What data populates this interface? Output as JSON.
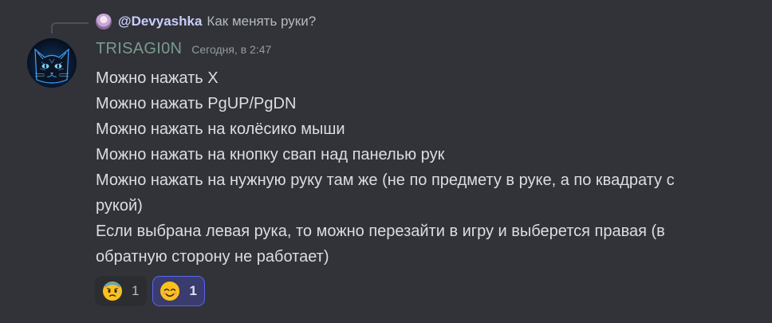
{
  "reply": {
    "author": "@Devyashka",
    "text": "Как менять руки?"
  },
  "message": {
    "author": "TRISAGI0N",
    "timestamp": "Сегодня, в 2:47",
    "lines": [
      "Можно нажать X",
      "Можно нажать PgUP/PgDN",
      "Можно нажать на колёсико мыши",
      "Можно нажать на кнопку свап над панелью рук",
      "Можно нажать на нужную руку там же (не по предмету в руке, а по квадрату с",
      "рукой)",
      "Если выбрана левая рука, то можно перезайти в игру и выберется правая (в",
      "обратную сторону не работает)"
    ]
  },
  "reactions": [
    {
      "emoji": "anxious-face-with-sweat-icon",
      "count": "1",
      "active": false
    },
    {
      "emoji": "smiling-face-with-smiling-eyes-icon",
      "count": "1",
      "active": true
    }
  ],
  "colors": {
    "background": "#313338",
    "author": "#7a9a8e",
    "reply_author": "#c9cdfb",
    "active_reaction_border": "#5865f2",
    "active_reaction_bg": "#3a3c6e"
  }
}
